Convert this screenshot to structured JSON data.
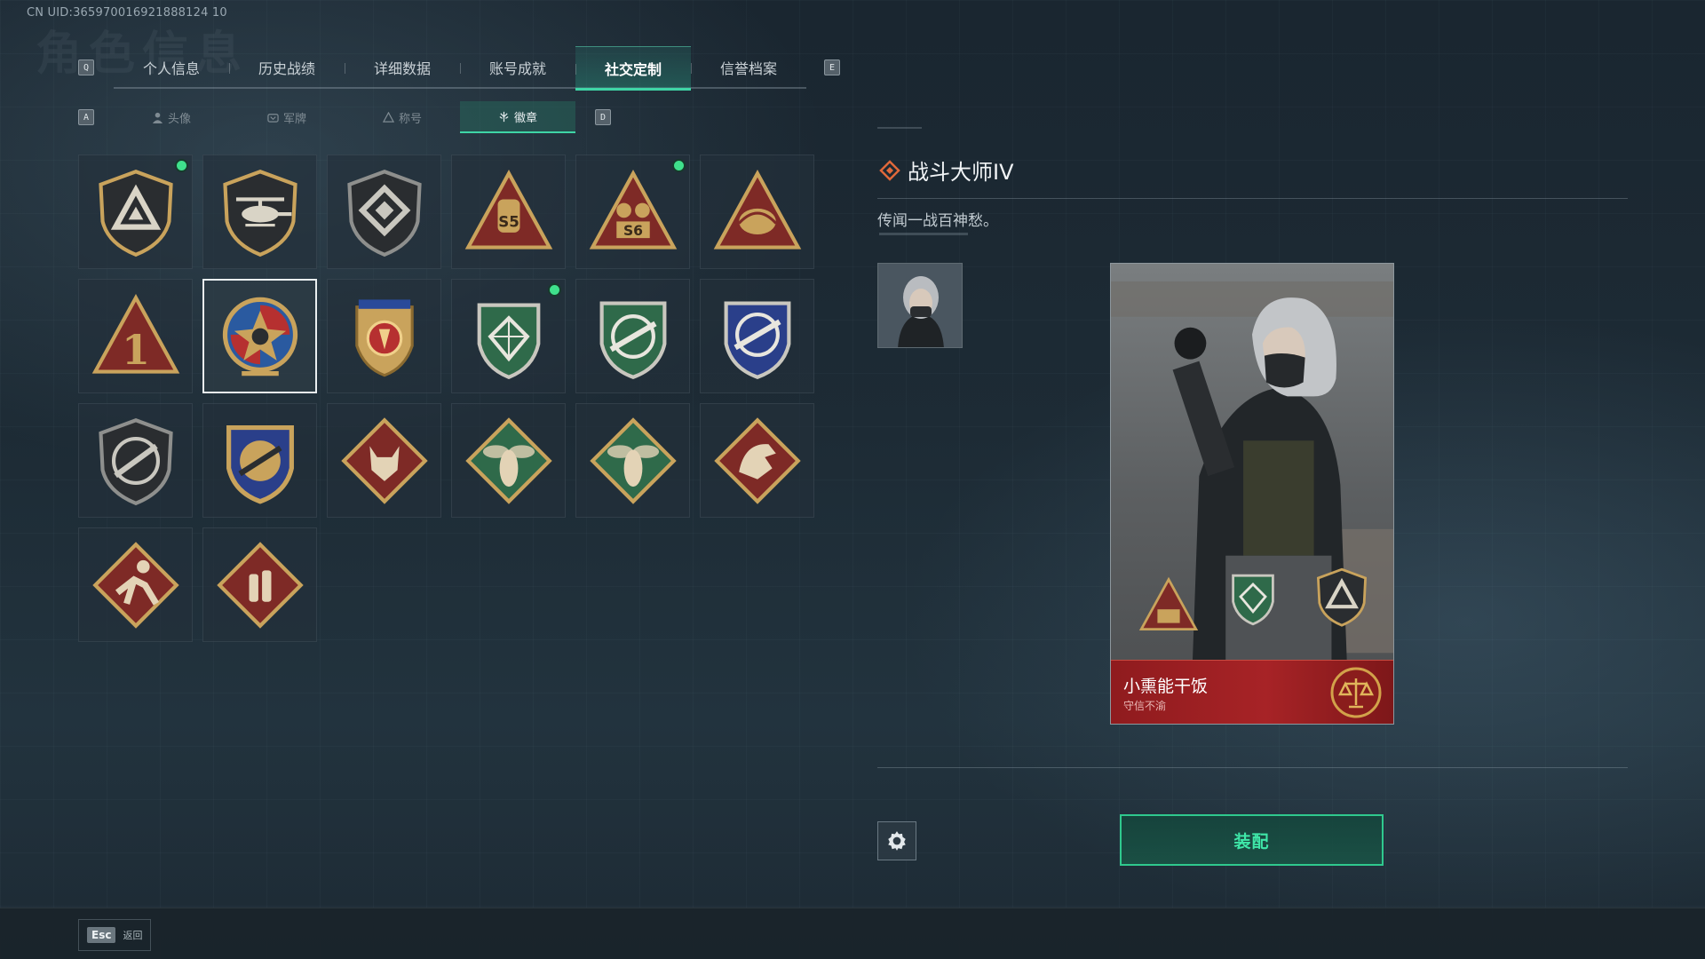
{
  "header": {
    "uid": "CN UID:365970016921888124 10",
    "bg_title": "角色信息"
  },
  "main_tabs": {
    "left_key": "Q",
    "right_key": "E",
    "items": [
      {
        "label": "个人信息",
        "active": false
      },
      {
        "label": "历史战绩",
        "active": false
      },
      {
        "label": "详细数据",
        "active": false
      },
      {
        "label": "账号成就",
        "active": false
      },
      {
        "label": "社交定制",
        "active": true
      },
      {
        "label": "信誉档案",
        "active": false
      }
    ]
  },
  "sub_tabs": {
    "left_key": "A",
    "right_key": "D",
    "items": [
      {
        "label": "头像",
        "icon": "person-icon",
        "active": false
      },
      {
        "label": "军牌",
        "icon": "dogtag-icon",
        "active": false
      },
      {
        "label": "称号",
        "icon": "title-icon",
        "active": false
      },
      {
        "label": "徽章",
        "icon": "badge-icon",
        "active": true
      }
    ]
  },
  "badges": [
    {
      "icon": "shield-triangle-badge-icon",
      "new": true,
      "selected": false
    },
    {
      "icon": "helicopter-badge-icon",
      "new": false,
      "selected": false
    },
    {
      "icon": "diamond-shield-badge-icon",
      "new": false,
      "selected": false
    },
    {
      "icon": "s5-badge-icon",
      "text": "S5",
      "new": false,
      "selected": false
    },
    {
      "icon": "s6-badge-icon",
      "text": "S6",
      "new": true,
      "selected": false
    },
    {
      "icon": "gold-triangle-badge-icon",
      "new": false,
      "selected": false
    },
    {
      "icon": "number-one-badge-icon",
      "text": "1",
      "new": false,
      "selected": false
    },
    {
      "icon": "star-skull-badge-icon",
      "new": false,
      "selected": true
    },
    {
      "icon": "gold-eagle-badge-icon",
      "new": false,
      "selected": false
    },
    {
      "icon": "green-diamond-badge-icon",
      "new": true,
      "selected": false
    },
    {
      "icon": "green-rifle-badge-icon",
      "new": false,
      "selected": false
    },
    {
      "icon": "blue-rifle-badge-icon",
      "new": false,
      "selected": false
    },
    {
      "icon": "shotgun-badge-icon",
      "new": false,
      "selected": false
    },
    {
      "icon": "gold-shotgun-badge-icon",
      "new": false,
      "selected": false
    },
    {
      "icon": "wolf-badge-icon",
      "new": false,
      "selected": false
    },
    {
      "icon": "bee-badge-icon",
      "new": false,
      "selected": false
    },
    {
      "icon": "bee-badge-2-icon",
      "new": false,
      "selected": false
    },
    {
      "icon": "dragon-badge-icon",
      "new": false,
      "selected": false
    },
    {
      "icon": "runner-badge-icon",
      "new": false,
      "selected": false
    },
    {
      "icon": "supplies-badge-icon",
      "new": false,
      "selected": false
    }
  ],
  "detail": {
    "title": "战斗大师IV",
    "description": "传闻一战百神愁。"
  },
  "card": {
    "player_name": "小熏能干饭",
    "player_title": "守信不渝"
  },
  "actions": {
    "equip_label": "装配"
  },
  "footer": {
    "esc_key": "Esc",
    "esc_label": "返回"
  },
  "colors": {
    "accent": "#3fd5a6",
    "new_dot": "#3fe08c",
    "name_bar": "#a72326",
    "badge_gold": "#c9a35c",
    "badge_red": "#7e2a26"
  }
}
